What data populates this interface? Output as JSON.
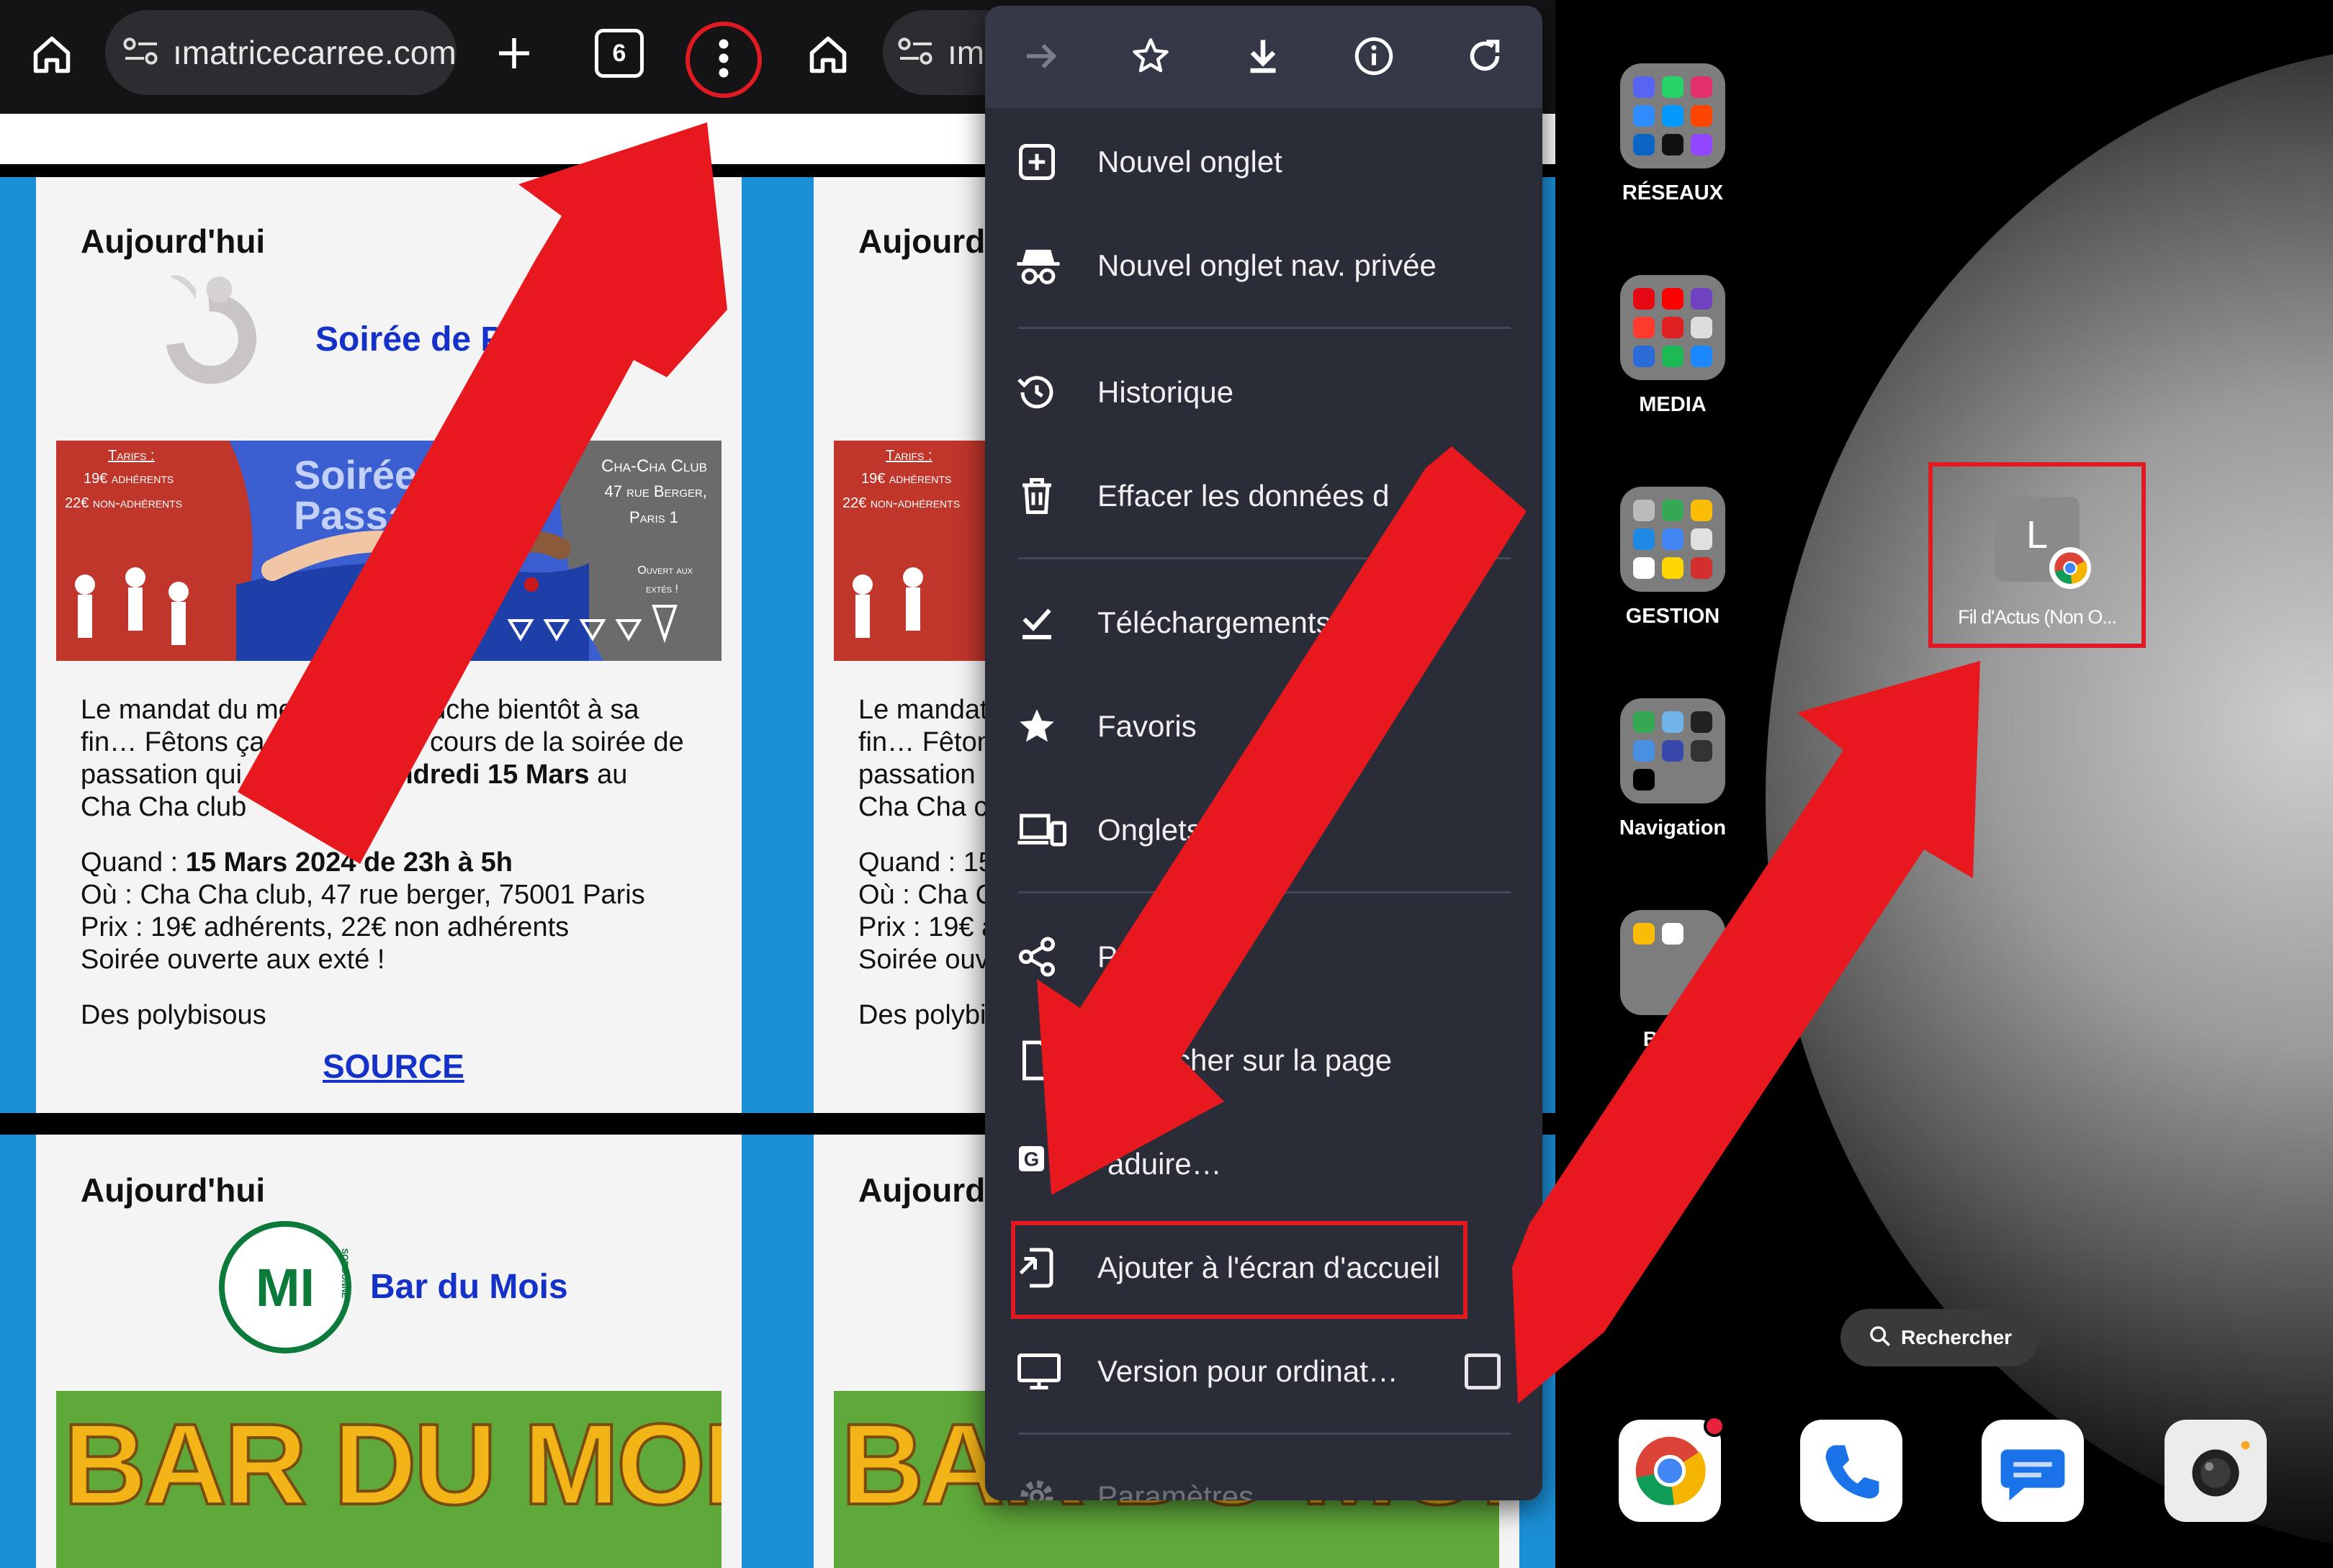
{
  "browser": {
    "tab1_url": "ımatricecarree.com",
    "tab2_url": "ım",
    "tab_count": "6",
    "cards": [
      {
        "today": "Aujourd'hui",
        "event_title": "Soirée de Passation",
        "poster": {
          "tarifs_title": "Tarifs :",
          "tarif_1": "19€ adhérents",
          "tarif_2": "22€ non-adhérents",
          "headline": "Soirée de Passation",
          "club_name": "Cha-Cha Club",
          "address_1": "47 rue Berger,",
          "address_2": "Paris 1",
          "open_1": "Ouvert aux",
          "open_2": "extés !"
        },
        "desc_1": "Le mandat du mer",
        "desc_2": "touche bientôt à sa",
        "desc_3": "fin… Fêtons ça e",
        "desc_4": "u cours de la soirée de",
        "desc_5": "passation qui",
        "desc_6": "Vendredi 15 Mars",
        "desc_7": " au",
        "desc_8": "Cha Cha club",
        "when_label": "Quand : ",
        "when_value": "15 Mars 2024 de 23h à 5h",
        "where": "Où : Cha Cha club, 47 rue berger, 75001 Paris",
        "price": "Prix : 19€ adhérents, 22€ non adhérents",
        "open": "Soirée ouverte aux exté !",
        "bye": "Des polybisous",
        "source": "SOURCE"
      },
      {
        "today": "Aujourd'",
        "desc_1": "Le mandat",
        "desc_2": "fin… Fêton",
        "desc_3": "passation",
        "desc_4": "Cha Cha c",
        "when": "Quand : 15",
        "where": "Où : Cha C",
        "price": "Prix : 19€ a",
        "open": "Soirée ouv",
        "bye": "Des polybi"
      },
      {
        "today": "Aujourd'hui",
        "event_title": "Bar du Mois",
        "logo_text": "MI",
        "logo_ring": "SORBONNE",
        "poster_text": "BAR DU MOIS"
      },
      {
        "today": "Aujourd'",
        "poster_text": "BAR DU MOIS"
      }
    ]
  },
  "menu": {
    "items": [
      {
        "label": "Nouvel onglet",
        "icon": "new-tab-icon"
      },
      {
        "label": "Nouvel onglet nav. privée",
        "icon": "incognito-icon"
      },
      {
        "label": "Historique",
        "icon": "history-icon"
      },
      {
        "label": "Effacer les données d",
        "icon": "trash-icon"
      },
      {
        "label": "Téléchargements",
        "icon": "download-check-icon"
      },
      {
        "label": "Favoris",
        "icon": "star-icon"
      },
      {
        "label": "Onglets r",
        "icon": "devices-icon"
      },
      {
        "label": "Part",
        "icon": "share-icon"
      },
      {
        "label": "rcher sur la page",
        "icon": "find-in-page-icon"
      },
      {
        "label": "aduire…",
        "icon": "translate-icon"
      },
      {
        "label": "Ajouter à l'écran d'accueil",
        "icon": "add-to-home-icon"
      },
      {
        "label": "Version pour ordinat…",
        "icon": "desktop-icon"
      },
      {
        "label": "Paramètres",
        "icon": "settings-icon"
      }
    ]
  },
  "home": {
    "folders": [
      {
        "label": "RÉSEAUX"
      },
      {
        "label": "MEDIA"
      },
      {
        "label": "GESTION"
      },
      {
        "label": "Navigation"
      },
      {
        "label": "Burea"
      }
    ],
    "shortcut": {
      "letter": "L",
      "label": "Fil d'Actus (Non O..."
    },
    "search_label": "Rechercher",
    "dock": [
      "chrome-icon",
      "phone-icon",
      "messages-icon",
      "camera-icon"
    ]
  },
  "colors": {
    "annotation_red": "#e01a22",
    "link_blue": "#1432c8",
    "menu_bg": "#2a2d38",
    "page_blue": "#1b8fd6"
  }
}
